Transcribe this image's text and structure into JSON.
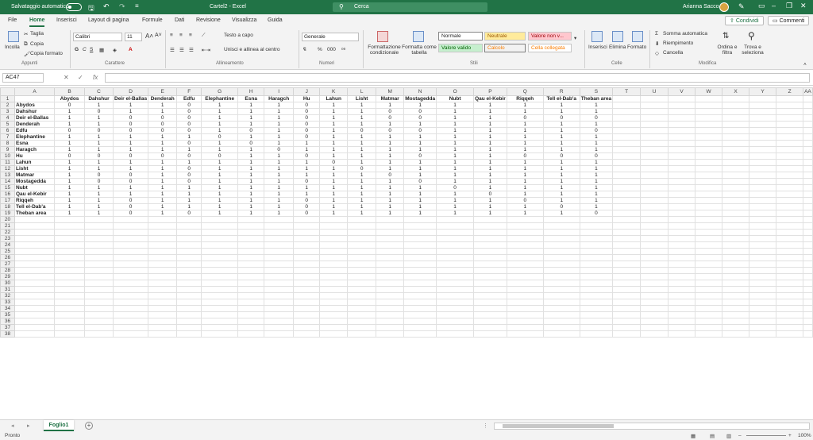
{
  "titlebar": {
    "autosave": "Salvataggio automatico",
    "title": "Cartel2 - Excel",
    "search": "Cerca",
    "user": "Arianna Sacco"
  },
  "tabs": [
    "File",
    "Home",
    "Inserisci",
    "Layout di pagina",
    "Formule",
    "Dati",
    "Revisione",
    "Visualizza",
    "Guida"
  ],
  "share": "Condividi",
  "comments": "Commenti",
  "ribbon": {
    "clipboard": {
      "paste": "Incolla",
      "cut": "Taglia",
      "copy": "Copia",
      "format": "Copia formato",
      "group": "Appunti"
    },
    "font": {
      "name": "Calibri",
      "size": "11",
      "bold": "G",
      "italic": "C",
      "underline": "S",
      "group": "Carattere"
    },
    "align": {
      "wrap": "Testo a capo",
      "merge": "Unisci e allinea al centro",
      "group": "Allineamento"
    },
    "number": {
      "format": "Generale",
      "group": "Numeri"
    },
    "styles": {
      "cond": "Formattazione condizionale",
      "table": "Formatta come tabella",
      "normal": "Normale",
      "neutral": "Neutrale",
      "bad": "Valore non v...",
      "good": "Valore valido",
      "calc": "Calcolo",
      "linked": "Cella collegata",
      "group": "Stili"
    },
    "cells": {
      "insert": "Inserisci",
      "delete": "Elimina",
      "format": "Formato",
      "group": "Celle"
    },
    "edit": {
      "autosum": "Somma automatica",
      "fill": "Riempimento",
      "clear": "Cancella",
      "sort": "Ordina e filtra",
      "find": "Trova e seleziona",
      "group": "Modifica"
    }
  },
  "formula": {
    "namebox": "AC47",
    "fx": "fx",
    "value": ""
  },
  "grid": {
    "columns": [
      "A",
      "B",
      "C",
      "D",
      "E",
      "F",
      "G",
      "H",
      "I",
      "J",
      "K",
      "L",
      "M",
      "N",
      "O",
      "P",
      "Q",
      "R",
      "S",
      "T",
      "U",
      "V",
      "W",
      "X",
      "Y",
      "Z",
      "AA"
    ],
    "headers": [
      "Abydos",
      "Dahshur",
      "Deir el-Ballas",
      "Denderah",
      "Edfu",
      "Elephantine",
      "Esna",
      "Haragch",
      "Hu",
      "Lahun",
      "Lisht",
      "Matmar",
      "Mostagedda",
      "Nubt",
      "Qau el-Kebir",
      "Riqqeh",
      "Tell el-Dab'a",
      "Theban area"
    ],
    "rows": [
      [
        "Abydos",
        [
          0,
          1,
          1,
          1,
          0,
          1,
          1,
          1,
          0,
          1,
          1,
          1,
          1,
          1,
          1,
          1,
          1,
          1
        ]
      ],
      [
        "Dahshur",
        [
          1,
          0,
          1,
          1,
          0,
          1,
          1,
          1,
          0,
          1,
          1,
          0,
          0,
          1,
          1,
          1,
          1,
          1
        ]
      ],
      [
        "Deir el-Ballas",
        [
          1,
          1,
          0,
          0,
          0,
          1,
          1,
          1,
          0,
          1,
          1,
          0,
          0,
          1,
          1,
          0,
          0,
          0
        ]
      ],
      [
        "Denderah",
        [
          1,
          1,
          0,
          0,
          0,
          1,
          1,
          1,
          0,
          1,
          1,
          1,
          1,
          1,
          1,
          1,
          1,
          1
        ]
      ],
      [
        "Edfu",
        [
          0,
          0,
          0,
          0,
          0,
          1,
          0,
          1,
          0,
          1,
          0,
          0,
          0,
          1,
          1,
          1,
          1,
          0
        ]
      ],
      [
        "Elephantine",
        [
          1,
          1,
          1,
          1,
          1,
          0,
          1,
          1,
          0,
          1,
          1,
          1,
          1,
          1,
          1,
          1,
          1,
          1
        ]
      ],
      [
        "Esna",
        [
          1,
          1,
          1,
          1,
          0,
          1,
          0,
          1,
          1,
          1,
          1,
          1,
          1,
          1,
          1,
          1,
          1,
          1
        ]
      ],
      [
        "Haragch",
        [
          1,
          1,
          1,
          1,
          1,
          1,
          1,
          0,
          1,
          1,
          1,
          1,
          1,
          1,
          1,
          1,
          1,
          1
        ]
      ],
      [
        "Hu",
        [
          0,
          0,
          0,
          0,
          0,
          0,
          1,
          1,
          0,
          1,
          1,
          1,
          0,
          1,
          1,
          0,
          0,
          0
        ]
      ],
      [
        "Lahun",
        [
          1,
          1,
          1,
          1,
          1,
          1,
          1,
          1,
          1,
          0,
          1,
          1,
          1,
          1,
          1,
          1,
          1,
          1
        ]
      ],
      [
        "Lisht",
        [
          1,
          1,
          1,
          1,
          0,
          1,
          1,
          1,
          1,
          1,
          0,
          1,
          1,
          1,
          1,
          1,
          1,
          1
        ]
      ],
      [
        "Matmar",
        [
          1,
          0,
          0,
          1,
          0,
          1,
          1,
          1,
          1,
          1,
          1,
          0,
          1,
          1,
          1,
          1,
          1,
          1
        ]
      ],
      [
        "Mostagedda",
        [
          1,
          0,
          0,
          1,
          0,
          1,
          1,
          1,
          0,
          1,
          1,
          1,
          0,
          1,
          1,
          1,
          1,
          1
        ]
      ],
      [
        "Nubt",
        [
          1,
          1,
          1,
          1,
          1,
          1,
          1,
          1,
          1,
          1,
          1,
          1,
          1,
          0,
          1,
          1,
          1,
          1
        ]
      ],
      [
        "Qau el-Kebir",
        [
          1,
          1,
          1,
          1,
          1,
          1,
          1,
          1,
          1,
          1,
          1,
          1,
          1,
          1,
          0,
          1,
          1,
          1
        ]
      ],
      [
        "Riqqeh",
        [
          1,
          1,
          0,
          1,
          1,
          1,
          1,
          1,
          0,
          1,
          1,
          1,
          1,
          1,
          1,
          0,
          1,
          1
        ]
      ],
      [
        "Tell el-Dab'a",
        [
          1,
          1,
          0,
          1,
          1,
          1,
          1,
          1,
          0,
          1,
          1,
          1,
          1,
          1,
          1,
          1,
          0,
          1
        ]
      ],
      [
        "Theban area",
        [
          1,
          1,
          0,
          1,
          0,
          1,
          1,
          1,
          0,
          1,
          1,
          1,
          1,
          1,
          1,
          1,
          1,
          0
        ]
      ]
    ],
    "total_rows": 38
  },
  "sheet": {
    "tab": "Foglio1"
  },
  "status": {
    "ready": "Pronto",
    "zoom": "100%"
  }
}
